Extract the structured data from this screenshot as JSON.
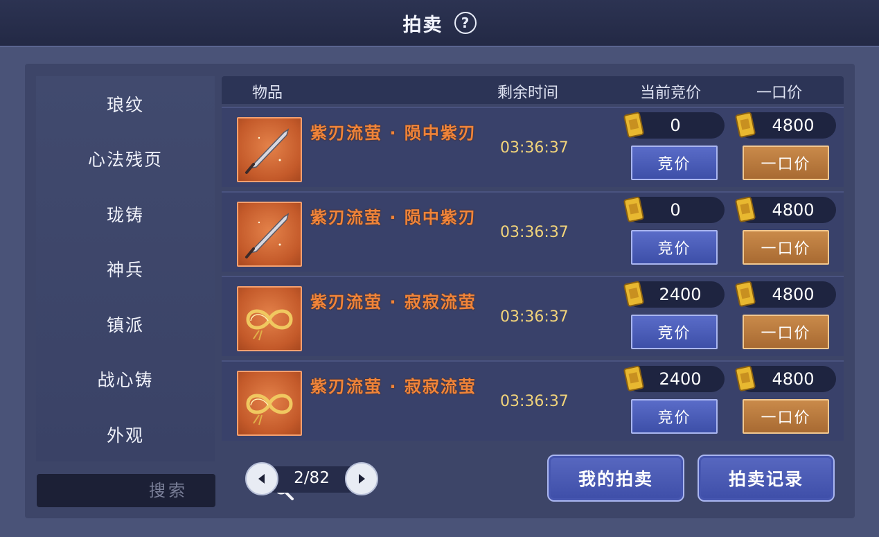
{
  "title": "拍卖",
  "help_symbol": "?",
  "sidebar": {
    "items": [
      {
        "label": "琅纹"
      },
      {
        "label": "心法残页"
      },
      {
        "label": "珑铸"
      },
      {
        "label": "神兵"
      },
      {
        "label": "镇派"
      },
      {
        "label": "战心铸"
      },
      {
        "label": "外观"
      }
    ]
  },
  "search": {
    "placeholder": "搜索"
  },
  "table": {
    "headers": {
      "item": "物品",
      "time": "剩余时间",
      "bid": "当前竞价",
      "buyout": "一口价"
    },
    "rows": [
      {
        "name": "紫刃流萤 · 陨中紫刃",
        "time": "03:36:37",
        "bid": "0",
        "buyout": "4800",
        "icon": "blade-icon"
      },
      {
        "name": "紫刃流萤 · 陨中紫刃",
        "time": "03:36:37",
        "bid": "0",
        "buyout": "4800",
        "icon": "blade-icon"
      },
      {
        "name": "紫刃流萤 · 寂寂流萤",
        "time": "03:36:37",
        "bid": "2400",
        "buyout": "4800",
        "icon": "infinity-ribbon-icon"
      },
      {
        "name": "紫刃流萤 · 寂寂流萤",
        "time": "03:36:37",
        "bid": "2400",
        "buyout": "4800",
        "icon": "infinity-ribbon-icon"
      }
    ],
    "bid_button": "竞价",
    "buyout_button": "一口价"
  },
  "pager": {
    "text": "2/82"
  },
  "actions": {
    "my_auctions": "我的拍卖",
    "auction_log": "拍卖记录"
  },
  "colors": {
    "item_name": "#f0843a",
    "time": "#f2d47a",
    "bid_button": "#4a5cb8",
    "buyout_button": "#b87a3e"
  }
}
